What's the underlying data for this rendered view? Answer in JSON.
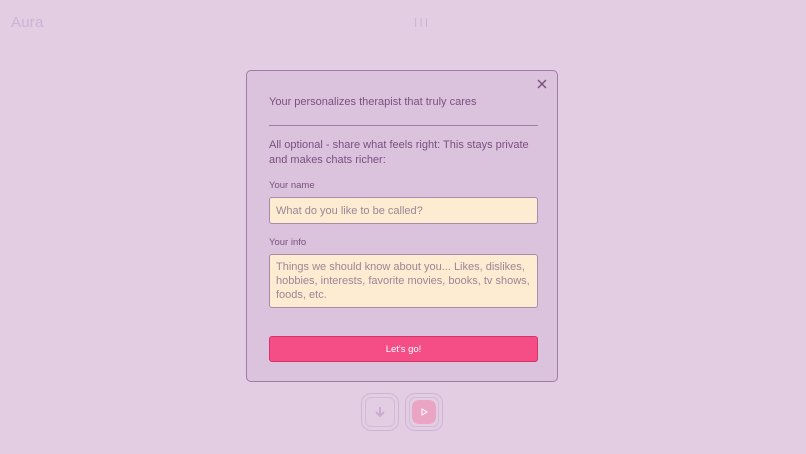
{
  "app": {
    "brand": "Aura",
    "top_indicator": "|||"
  },
  "modal": {
    "title": "Your personalizes therapist that truly cares",
    "intro": "All optional - share what feels right: This stays private and makes chats richer:",
    "name_label": "Your name",
    "name_value": "",
    "name_placeholder": "What do you like to be called?",
    "info_label": "Your info",
    "info_value": "",
    "info_placeholder": "Things we should know about you... Likes, dislikes, hobbies, interests, favorite movies, books, tv shows, foods, etc.",
    "submit_label": "Let's go!",
    "close_icon": "close-icon"
  },
  "controls": {
    "download_icon": "download-arrow-icon",
    "play_icon": "play-icon"
  },
  "colors": {
    "background": "#e3cde3",
    "modal_bg": "#dbc3dd",
    "accent": "#f54d85",
    "input_bg": "#fdebd2",
    "text": "#7a4f80"
  }
}
